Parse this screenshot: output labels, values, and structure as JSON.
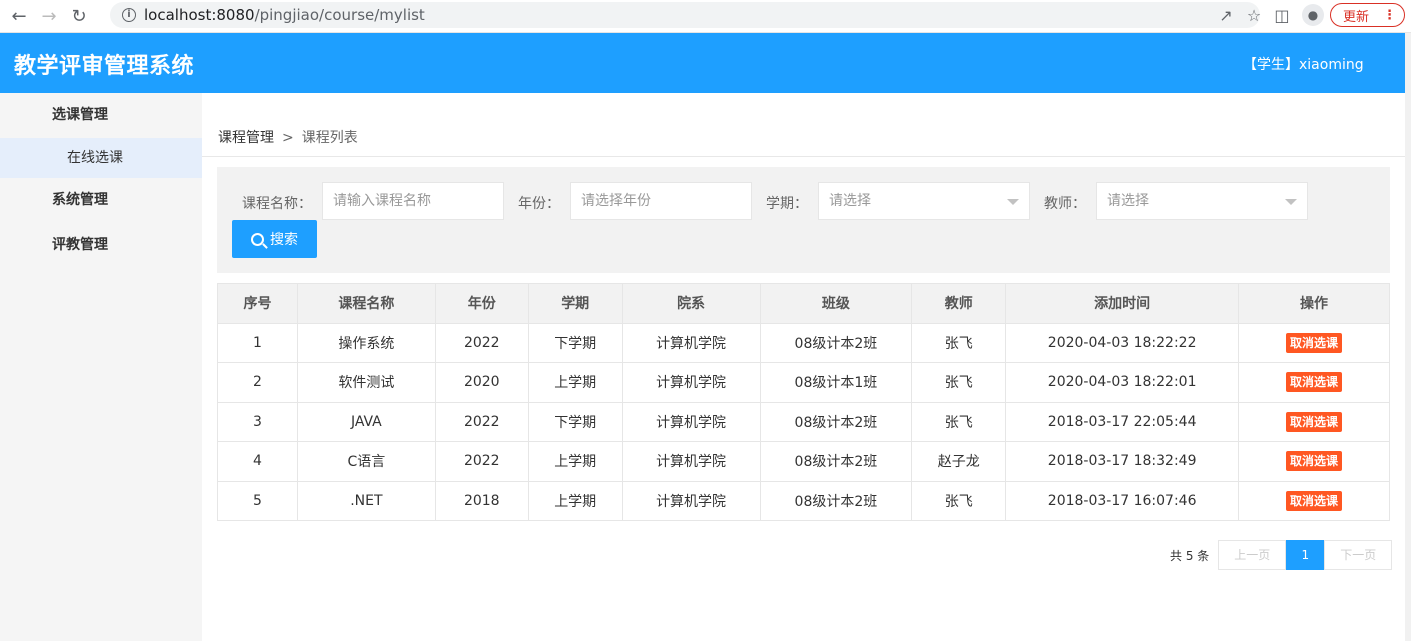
{
  "browser": {
    "url_host": "localhost:8080",
    "url_path": "/pingjiao/course/mylist",
    "update_label": "更新"
  },
  "header": {
    "title": "教学评审管理系统",
    "user": "【学生】xiaoming",
    "accent_color": "#1e9fff"
  },
  "sidebar": {
    "groups": [
      {
        "label": "选课管理",
        "items": [
          {
            "label": "在线选课"
          }
        ]
      },
      {
        "label": "系统管理"
      },
      {
        "label": "评教管理"
      }
    ]
  },
  "breadcrumb": {
    "parent": "课程管理",
    "separator": ">",
    "current": "课程列表"
  },
  "search": {
    "course_label": "课程名称：",
    "course_placeholder": "请输入课程名称",
    "year_label": "年份：",
    "year_placeholder": "请选择年份",
    "term_label": "学期：",
    "term_placeholder": "请选择",
    "teacher_label": "教师：",
    "teacher_placeholder": "请选择",
    "button_label": "搜索"
  },
  "table": {
    "headers": [
      "序号",
      "课程名称",
      "年份",
      "学期",
      "院系",
      "班级",
      "教师",
      "添加时间",
      "操作"
    ],
    "rows": [
      [
        "1",
        "操作系统",
        "2022",
        "下学期",
        "计算机学院",
        "08级计本2班",
        "张飞",
        "2020-04-03 18:22:22",
        "取消选课"
      ],
      [
        "2",
        "软件测试",
        "2020",
        "上学期",
        "计算机学院",
        "08级计本1班",
        "张飞",
        "2020-04-03 18:22:01",
        "取消选课"
      ],
      [
        "3",
        "JAVA",
        "2022",
        "下学期",
        "计算机学院",
        "08级计本2班",
        "张飞",
        "2018-03-17 22:05:44",
        "取消选课"
      ],
      [
        "4",
        "C语言",
        "2022",
        "上学期",
        "计算机学院",
        "08级计本2班",
        "赵子龙",
        "2018-03-17 18:32:49",
        "取消选课"
      ],
      [
        "5",
        ".NET",
        "2018",
        "上学期",
        "计算机学院",
        "08级计本2班",
        "张飞",
        "2018-03-17 16:07:46",
        "取消选课"
      ]
    ]
  },
  "pager": {
    "total": "共 5 条",
    "prev": "上一页",
    "current": "1",
    "next": "下一页"
  }
}
